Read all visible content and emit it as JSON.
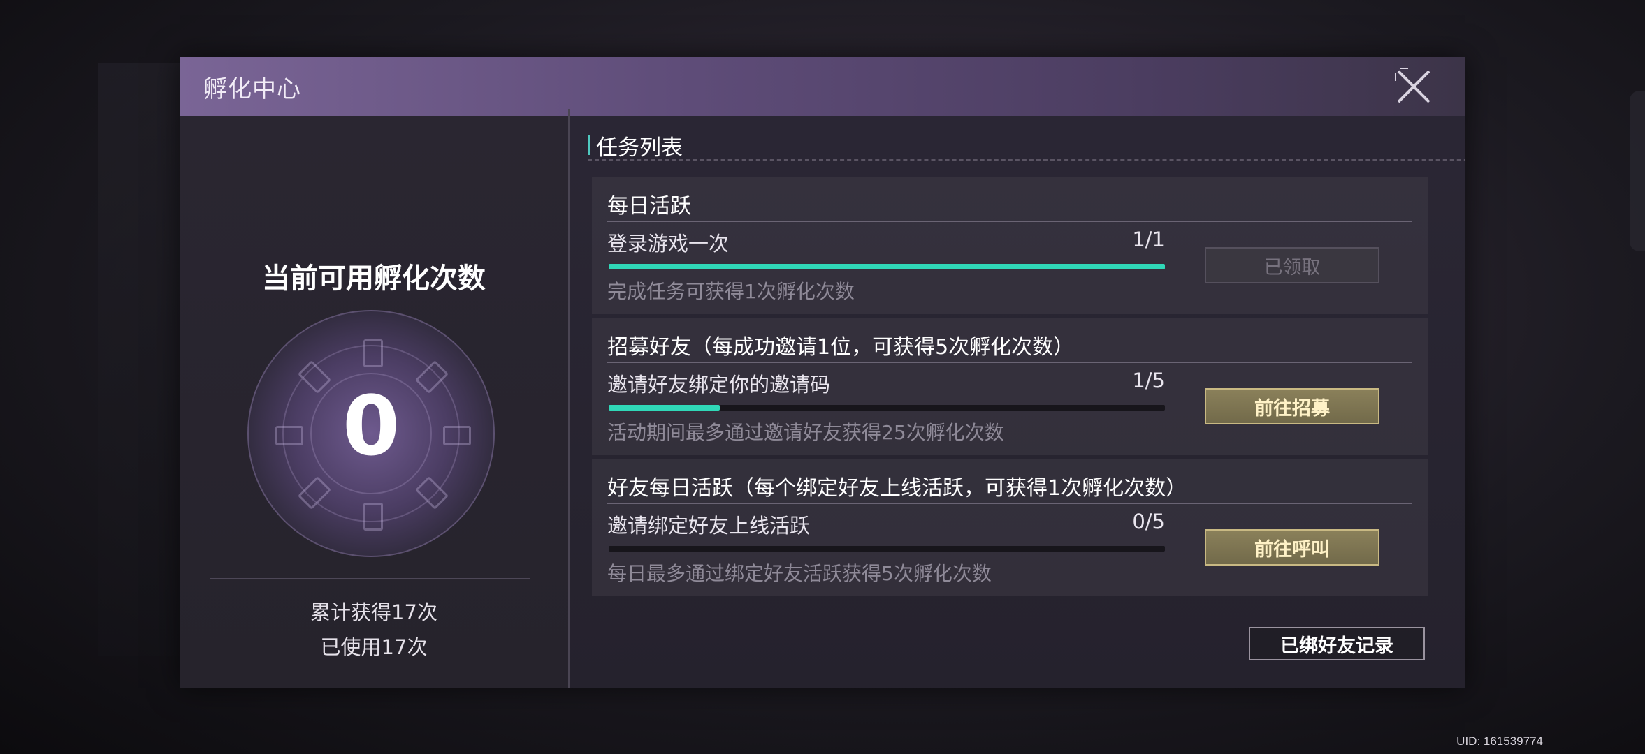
{
  "dialog": {
    "title": "孵化中心"
  },
  "left": {
    "avail_title": "当前可用孵化次数",
    "count": "0",
    "total_obtained": "累计获得17次",
    "used": "已使用17次"
  },
  "tasks": {
    "section_title": "任务列表",
    "items": [
      {
        "header": "每日活跃",
        "desc": "登录游戏一次",
        "progress_text": "1/1",
        "progress": 1.0,
        "note": "完成任务可获得1次孵化次数",
        "button": "已领取",
        "button_state": "claimed"
      },
      {
        "header": "招募好友（每成功邀请1位，可获得5次孵化次数）",
        "desc": "邀请好友绑定你的邀请码",
        "progress_text": "1/5",
        "progress": 0.2,
        "note": "活动期间最多通过邀请好友获得25次孵化次数",
        "button": "前往招募",
        "button_state": "go"
      },
      {
        "header": "好友每日活跃（每个绑定好友上线活跃，可获得1次孵化次数）",
        "desc": "邀请绑定好友上线活跃",
        "progress_text": "0/5",
        "progress": 0.0,
        "note": "每日最多通过绑定好友活跃获得5次孵化次数",
        "button": "前往呼叫",
        "button_state": "go"
      }
    ]
  },
  "bound_record_button": "已绑好友记录",
  "uid": "UID: 161539774",
  "colors": {
    "progress_fill": "#30d8b8",
    "section_accent": "#4fc9c0",
    "go_button_text": "#fff2c7",
    "title_bar": "#6f5a8c"
  },
  "icons": {
    "close": "close-icon"
  }
}
